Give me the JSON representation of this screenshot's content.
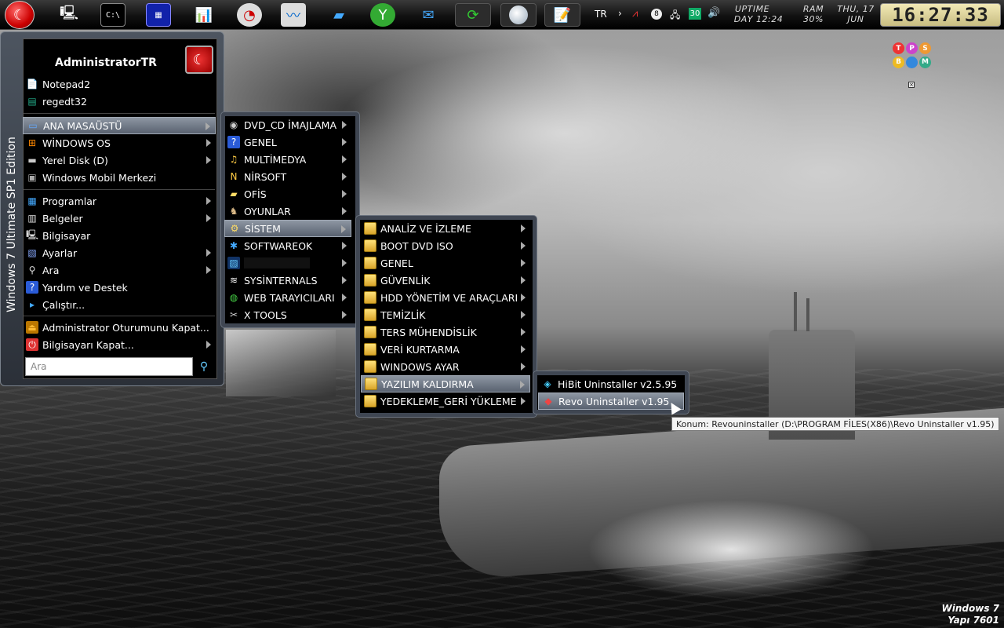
{
  "taskbar": {
    "lang": "TR",
    "uptime_label": "UPTIME",
    "uptime_value": "DAY 12:24",
    "ram_label": "RAM",
    "ram_value": "30%",
    "date_day": "THU, 17",
    "date_month": "JUN",
    "clock": "16:27:33",
    "tray_badge": "30"
  },
  "start_menu": {
    "edition_text": "Windows 7 Ultimate SP1 Edition",
    "user": "AdministratorTR",
    "pinned": [
      {
        "label": "Notepad2",
        "icon": "notepad-icon"
      },
      {
        "label": "regedt32",
        "icon": "registry-icon"
      }
    ],
    "places": [
      {
        "label": "ANA MASAÜSTÜ",
        "icon": "desktop-icon",
        "submenu": true,
        "selected": true
      },
      {
        "label": "WİNDOWS OS",
        "icon": "windows-icon",
        "submenu": true
      },
      {
        "label": "Yerel Disk (D)",
        "icon": "disk-icon",
        "submenu": true
      },
      {
        "label": "Windows Mobil Merkezi",
        "icon": "mobility-icon",
        "submenu": false
      }
    ],
    "system": [
      {
        "label": "Programlar",
        "icon": "programs-icon",
        "submenu": true
      },
      {
        "label": "Belgeler",
        "icon": "documents-icon",
        "submenu": true
      },
      {
        "label": "Bilgisayar",
        "icon": "computer-icon",
        "submenu": false
      },
      {
        "label": "Ayarlar",
        "icon": "settings-icon",
        "submenu": true
      },
      {
        "label": "Ara",
        "icon": "search-icon",
        "submenu": true
      },
      {
        "label": "Yardım ve Destek",
        "icon": "help-icon",
        "submenu": false
      },
      {
        "label": "Çalıştır...",
        "icon": "run-icon",
        "submenu": false
      }
    ],
    "session": [
      {
        "label": "Administrator Oturumunu Kapat...",
        "icon": "logoff-icon",
        "submenu": false
      },
      {
        "label": "Bilgisayarı Kapat...",
        "icon": "shutdown-icon",
        "submenu": true
      }
    ],
    "search_placeholder": "Ara"
  },
  "menu_level1": [
    {
      "label": "DVD_CD İMAJLAMA",
      "icon": "disc-icon"
    },
    {
      "label": "GENEL",
      "icon": "help-icon"
    },
    {
      "label": "MULTİMEDYA",
      "icon": "multimedia-icon"
    },
    {
      "label": "NİRSOFT",
      "icon": "nirsoft-icon"
    },
    {
      "label": "OFİS",
      "icon": "folder-icon"
    },
    {
      "label": "OYUNLAR",
      "icon": "games-icon"
    },
    {
      "label": "SİSTEM",
      "icon": "system-icon",
      "selected": true
    },
    {
      "label": "SOFTWAREOK",
      "icon": "softwareok-icon"
    },
    {
      "label": "",
      "icon": "image-icon"
    },
    {
      "label": "SYSİNTERNALS",
      "icon": "sysinternals-icon"
    },
    {
      "label": "WEB TARAYICILARI",
      "icon": "browser-icon"
    },
    {
      "label": "X TOOLS",
      "icon": "xtools-icon"
    }
  ],
  "menu_level2": [
    {
      "label": "ANALİZ VE İZLEME"
    },
    {
      "label": "BOOT DVD ISO"
    },
    {
      "label": "GENEL"
    },
    {
      "label": "GÜVENLİK"
    },
    {
      "label": "HDD YÖNETİM VE ARAÇLARI"
    },
    {
      "label": "TEMİZLİK"
    },
    {
      "label": "TERS MÜHENDİSLİK"
    },
    {
      "label": "VERİ KURTARMA"
    },
    {
      "label": "WINDOWS AYAR"
    },
    {
      "label": "YAZILIM KALDIRMA",
      "selected": true
    },
    {
      "label": "YEDEKLEME_GERİ YÜKLEME"
    }
  ],
  "menu_level3": [
    {
      "label": "HiBit Uninstaller v2.5.95",
      "icon": "hibit-icon"
    },
    {
      "label": "Revo Uninstaller v1.95",
      "icon": "revo-icon",
      "selected": true
    }
  ],
  "tooltip": "Konum: Revouninstaller (D:\\PROGRAM FİLES(X86)\\Revo Uninstaller v1.95)",
  "watermark": {
    "line1": "Windows 7",
    "line2": "Yapı 7601"
  },
  "desktop_logo": [
    "T",
    "P",
    "S",
    "B",
    "",
    "M"
  ],
  "colors": {
    "accent": "#596270",
    "orb": "#cc0000",
    "clock_bg": "#e6dca0"
  }
}
